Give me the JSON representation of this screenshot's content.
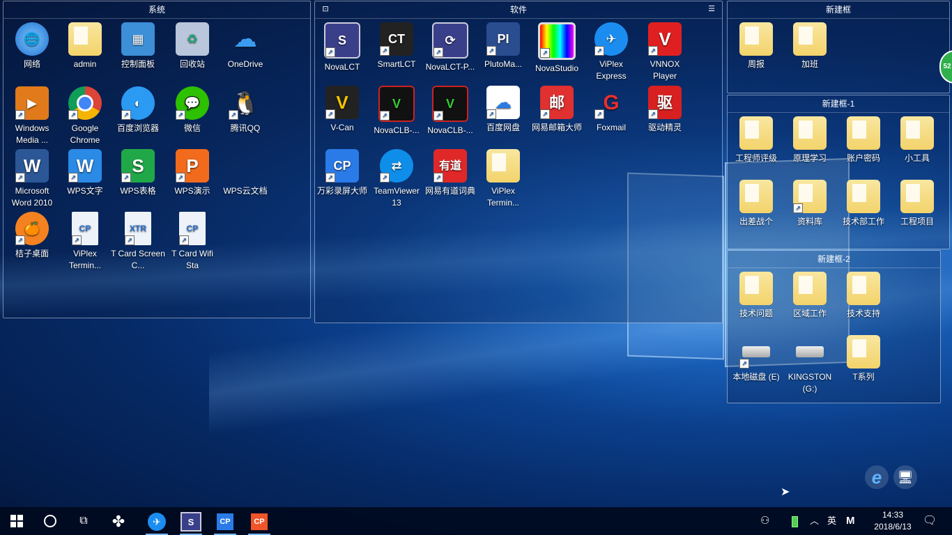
{
  "fences": {
    "system": {
      "title": "系统"
    },
    "software": {
      "title": "软件"
    },
    "new1": {
      "title": "新建框"
    },
    "new2": {
      "title": "新建框-1"
    },
    "new3": {
      "title": "新建框-2"
    }
  },
  "icons": {
    "system": [
      {
        "label": "网络"
      },
      {
        "label": "admin"
      },
      {
        "label": "控制面板"
      },
      {
        "label": "回收站"
      },
      {
        "label": "OneDrive"
      },
      {
        "label": "Windows Media ..."
      },
      {
        "label": "Google Chrome"
      },
      {
        "label": "百度浏览器"
      },
      {
        "label": "微信"
      },
      {
        "label": "腾讯QQ"
      },
      {
        "label": "Microsoft Word 2010"
      },
      {
        "label": "WPS文字"
      },
      {
        "label": "WPS表格"
      },
      {
        "label": "WPS演示"
      },
      {
        "label": "WPS云文档"
      },
      {
        "label": "桔子桌面"
      },
      {
        "label": "ViPlex Termin..."
      },
      {
        "label": "T Card Screen C..."
      },
      {
        "label": "T Card Wifi Sta"
      }
    ],
    "software": [
      {
        "label": "NovaLCT"
      },
      {
        "label": "SmartLCT"
      },
      {
        "label": "NovaLCT-P..."
      },
      {
        "label": "PlutoMa..."
      },
      {
        "label": "NovaStudio"
      },
      {
        "label": "ViPlex Express"
      },
      {
        "label": "VNNOX Player"
      },
      {
        "label": "V-Can"
      },
      {
        "label": "NovaCLB-..."
      },
      {
        "label": "NovaCLB-..."
      },
      {
        "label": "百度网盘"
      },
      {
        "label": "网易邮箱大师"
      },
      {
        "label": "Foxmail"
      },
      {
        "label": "驱动精灵"
      },
      {
        "label": "万彩录屏大师"
      },
      {
        "label": "TeamViewer 13"
      },
      {
        "label": "网易有道词典"
      },
      {
        "label": "ViPlex Termin..."
      }
    ],
    "new1": [
      {
        "label": "周报"
      },
      {
        "label": "加班"
      }
    ],
    "new2": [
      {
        "label": "工程师评级"
      },
      {
        "label": "原理学习"
      },
      {
        "label": "账户密码"
      },
      {
        "label": "小工具"
      },
      {
        "label": "出差战个"
      },
      {
        "label": "资料库"
      },
      {
        "label": "技术部工作"
      },
      {
        "label": "工程项目"
      }
    ],
    "new3": [
      {
        "label": "技术问题"
      },
      {
        "label": "区域工作"
      },
      {
        "label": "技术支持"
      },
      {
        "label": "本地磁盘 (E)"
      },
      {
        "label": "KINGSTON (G:)"
      },
      {
        "label": "T系列"
      }
    ]
  },
  "taskbar": {
    "tray_lang": "英",
    "tray_ime": "M",
    "time": "14:33",
    "date": "2018/6/13"
  },
  "side_badge": "52",
  "colors": {
    "accent": "#1a64bf",
    "taskbar": "#000a1e"
  }
}
